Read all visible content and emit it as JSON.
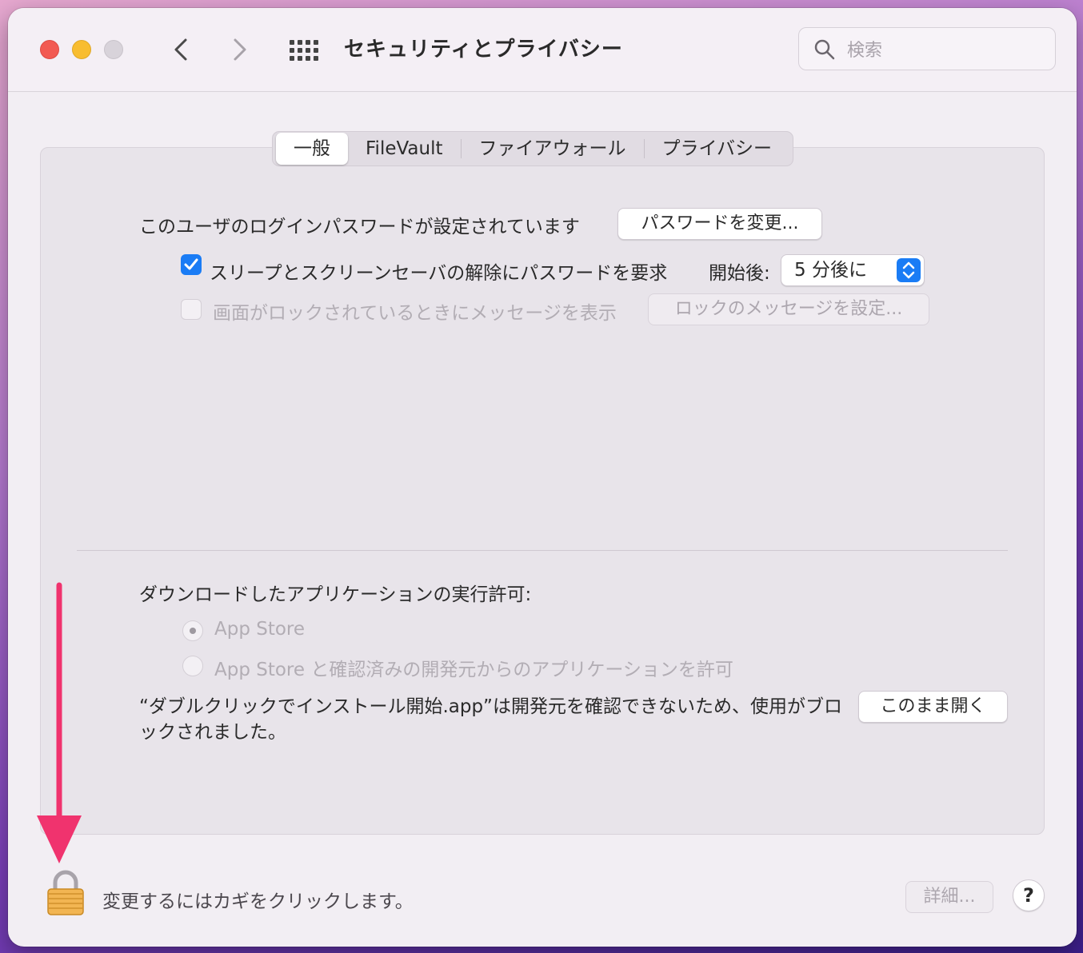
{
  "window": {
    "title": "セキュリティとプライバシー",
    "search_placeholder": "検索"
  },
  "tabs": [
    {
      "label": "一般",
      "active": true
    },
    {
      "label": "FileVault",
      "active": false
    },
    {
      "label": "ファイアウォール",
      "active": false
    },
    {
      "label": "プライバシー",
      "active": false
    }
  ],
  "general": {
    "password_set_text": "このユーザのログインパスワードが設定されています",
    "change_password_button": "パスワードを変更...",
    "require_password_label": "スリープとスクリーンセーバの解除にパスワードを要求",
    "require_password_checked": true,
    "start_after_label": "開始後:",
    "start_after_value": "5 分後に",
    "lock_message_label": "画面がロックされているときにメッセージを表示",
    "lock_message_checked": false,
    "set_lock_message_button": "ロックのメッセージを設定..."
  },
  "downloads": {
    "heading": "ダウンロードしたアプリケーションの実行許可:",
    "options": [
      {
        "label": "App Store",
        "selected": true
      },
      {
        "label": "App Store と確認済みの開発元からのアプリケーションを許可",
        "selected": false
      }
    ],
    "blocked_message": "“ダブルクリックでインストール開始.app”は開発元を確認できないため、使用がブロックされました。",
    "open_anyway_button": "このまま開く"
  },
  "footer": {
    "lock_text": "変更するにはカギをクリックします。",
    "advanced_button": "詳細...",
    "help_label": "?"
  },
  "colors": {
    "accent": "#1a7cf5",
    "annotation_arrow": "#f0336e"
  },
  "icons": [
    "close-light",
    "minimize-light",
    "zoom-light",
    "chevron-left-icon",
    "chevron-right-icon",
    "grid-icon",
    "search-icon",
    "checkmark-icon",
    "stepper-icon",
    "padlock-icon",
    "down-arrow-annotation"
  ]
}
